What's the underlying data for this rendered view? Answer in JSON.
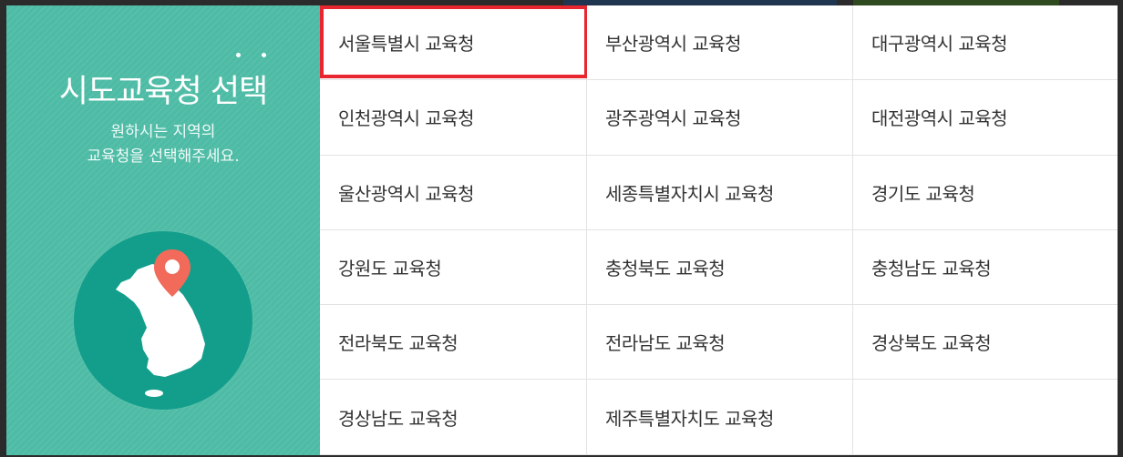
{
  "side": {
    "title": "시도교육청 선택",
    "subtitle_line1": "원하시는 지역의",
    "subtitle_line2": "교육청을 선택해주세요.",
    "map_icon": "korea-map-with-pin-icon",
    "accent_color": "#4dbba5",
    "circle_color": "#139e8c",
    "pin_color": "#f26a5a"
  },
  "offices": [
    {
      "label": "서울특별시 교육청",
      "selected": true
    },
    {
      "label": "부산광역시 교육청",
      "selected": false
    },
    {
      "label": "대구광역시 교육청",
      "selected": false
    },
    {
      "label": "인천광역시 교육청",
      "selected": false
    },
    {
      "label": "광주광역시 교육청",
      "selected": false
    },
    {
      "label": "대전광역시 교육청",
      "selected": false
    },
    {
      "label": "울산광역시 교육청",
      "selected": false
    },
    {
      "label": "세종특별자치시 교육청",
      "selected": false
    },
    {
      "label": "경기도 교육청",
      "selected": false
    },
    {
      "label": "강원도 교육청",
      "selected": false
    },
    {
      "label": "충청북도 교육청",
      "selected": false
    },
    {
      "label": "충청남도 교육청",
      "selected": false
    },
    {
      "label": "전라북도 교육청",
      "selected": false
    },
    {
      "label": "전라남도 교육청",
      "selected": false
    },
    {
      "label": "경상북도 교육청",
      "selected": false
    },
    {
      "label": "경상남도 교육청",
      "selected": false
    },
    {
      "label": "제주특별자치도 교육청",
      "selected": false
    }
  ],
  "selection_color": "#e8262f"
}
